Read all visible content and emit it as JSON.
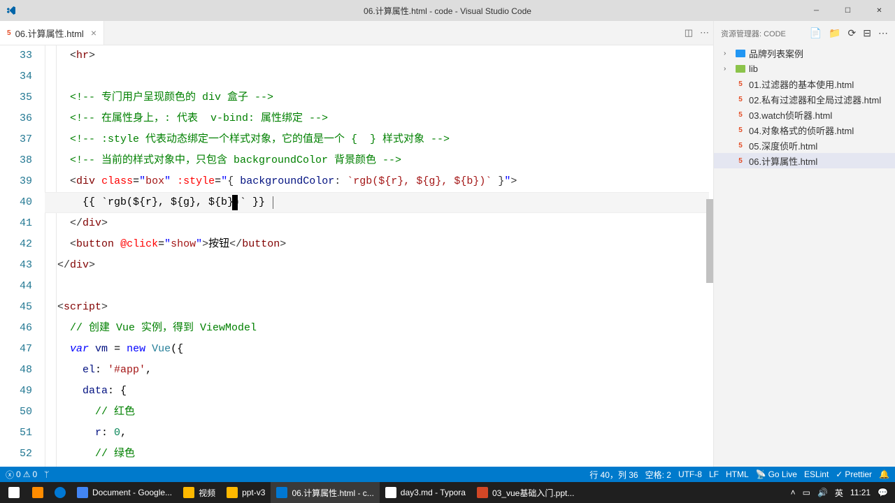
{
  "titlebar": {
    "title": "06.计算属性.html - code - Visual Studio Code"
  },
  "tabs": {
    "active": "06.计算属性.html"
  },
  "explorer": {
    "title": "资源管理器: CODE",
    "items": [
      {
        "type": "folder",
        "label": "品牌列表案例",
        "expandable": true,
        "folderClass": "folder-brand"
      },
      {
        "type": "folder",
        "label": "lib",
        "expandable": true,
        "folderClass": "folder-lib"
      },
      {
        "type": "file",
        "label": "01.过滤器的基本使用.html"
      },
      {
        "type": "file",
        "label": "02.私有过滤器和全局过滤器.html"
      },
      {
        "type": "file",
        "label": "03.watch侦听器.html"
      },
      {
        "type": "file",
        "label": "04.对象格式的侦听器.html"
      },
      {
        "type": "file",
        "label": "05.深度侦听.html"
      },
      {
        "type": "file",
        "label": "06.计算属性.html",
        "selected": true
      }
    ]
  },
  "editor": {
    "startLine": 33,
    "currentLine": 40,
    "cursorLeftCh": 36
  },
  "statusbar": {
    "errors": "0",
    "warnings": "0",
    "line_col": "行 40，列 36",
    "spaces": "空格: 2",
    "encoding": "UTF-8",
    "eol": "LF",
    "lang": "HTML",
    "golive": "Go Live",
    "eslint": "ESLint",
    "prettier": "Prettier"
  },
  "taskbar": {
    "items": [
      {
        "label": "Document - Google...",
        "icon_bg": "#4285f4"
      },
      {
        "label": "视频",
        "icon_bg": "#ffb900"
      },
      {
        "label": "ppt-v3",
        "icon_bg": "#ffb900"
      },
      {
        "label": "06.计算属性.html - c...",
        "icon_bg": "#0078d4",
        "active": true
      },
      {
        "label": "day3.md - Typora",
        "icon_bg": "#ffffff"
      },
      {
        "label": "03_vue基础入门.ppt...",
        "icon_bg": "#d24726"
      }
    ],
    "tray": {
      "lang": "英",
      "time": "11:21"
    }
  }
}
